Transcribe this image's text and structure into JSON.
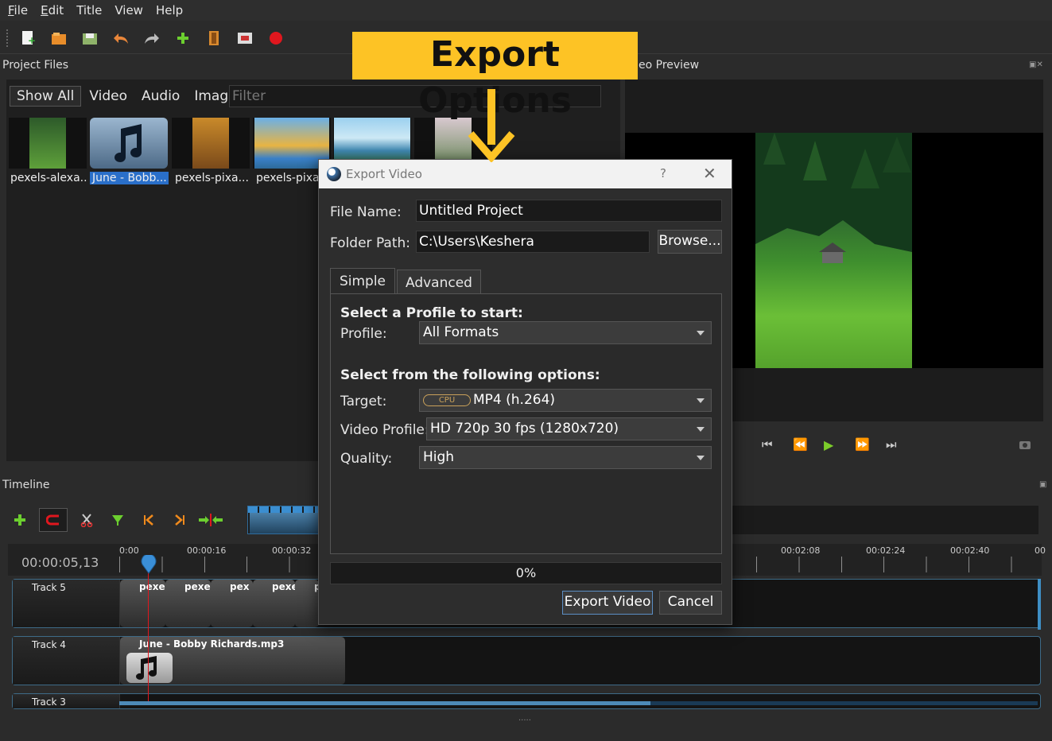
{
  "menu": [
    "File",
    "Edit",
    "Title",
    "View",
    "Help"
  ],
  "menu_underline": [
    "F",
    "E",
    "",
    "",
    ""
  ],
  "panels": {
    "project_files": "Project Files",
    "video_preview": "eo Preview",
    "timeline": "Timeline"
  },
  "filter_tabs": [
    "Show All",
    "Video",
    "Audio",
    "Image"
  ],
  "filter_placeholder": "Filter",
  "thumbnails": [
    "pexels-alexa...",
    "June - Bobb...",
    "pexels-pixa...",
    "pexels-pixa...",
    "",
    ""
  ],
  "timeline": {
    "timecode": "00:00:05,13",
    "ruler_labels": [
      "0:00",
      "00:00:16",
      "00:00:32",
      "00:02:08",
      "00:02:24",
      "00:02:40",
      "00"
    ],
    "tracks": [
      "Track 5",
      "Track 4",
      "Track 3"
    ],
    "track5_clips": [
      "pexe",
      "pexe",
      "pex",
      "pexe.",
      "pe"
    ],
    "track4_clip": "June - Bobby Richards.mp3"
  },
  "dialog": {
    "title": "Export Video",
    "help": "?",
    "close": "✕",
    "file_name_label": "File Name:",
    "file_name_value": "Untitled Project",
    "folder_path_label": "Folder Path:",
    "folder_path_value": "C:\\Users\\Keshera",
    "browse": "Browse...",
    "tabs": [
      "Simple",
      "Advanced"
    ],
    "profile_heading": "Select a Profile to start:",
    "profile_label": "Profile:",
    "profile_value": "All Formats",
    "options_heading": "Select from the following options:",
    "target_label": "Target:",
    "target_badge": "CPU",
    "target_value": "MP4 (h.264)",
    "video_profile_label": "Video Profile:",
    "video_profile_value": "HD 720p 30 fps (1280x720)",
    "quality_label": "Quality:",
    "quality_value": "High",
    "progress_text": "0%",
    "progress_value": 0,
    "export_button": "Export Video",
    "cancel_button": "Cancel"
  },
  "annotation": {
    "text": "Export Options",
    "color": "#fdc325"
  }
}
